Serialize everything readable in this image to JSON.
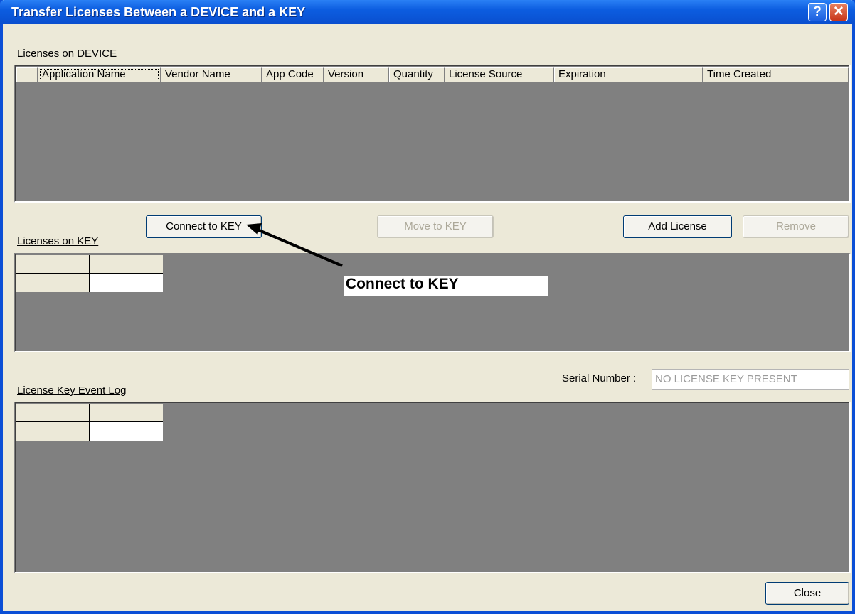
{
  "window": {
    "title": "Transfer Licenses Between a DEVICE and a KEY",
    "help_glyph": "?",
    "close_glyph": "✕"
  },
  "device_group": {
    "label": "Licenses on DEVICE",
    "columns": [
      "Application Name",
      "Vendor Name",
      "App Code",
      "Version",
      "Quantity",
      "License Source",
      "Expiration",
      "Time Created"
    ]
  },
  "buttons": {
    "connect": "Connect to KEY",
    "move": "Move to KEY",
    "add": "Add License",
    "remove": "Remove",
    "close": "Close"
  },
  "key_group": {
    "label": "Licenses on KEY"
  },
  "event_log_group": {
    "label": "License Key Event Log"
  },
  "serial": {
    "label": "Serial Number :",
    "value": "NO LICENSE KEY PRESENT"
  },
  "annotation": {
    "text": "Connect to KEY"
  },
  "colors": {
    "titlebar": "#0c5de0",
    "dialog_bg": "#ece9d8",
    "panel_bg": "#808080"
  }
}
